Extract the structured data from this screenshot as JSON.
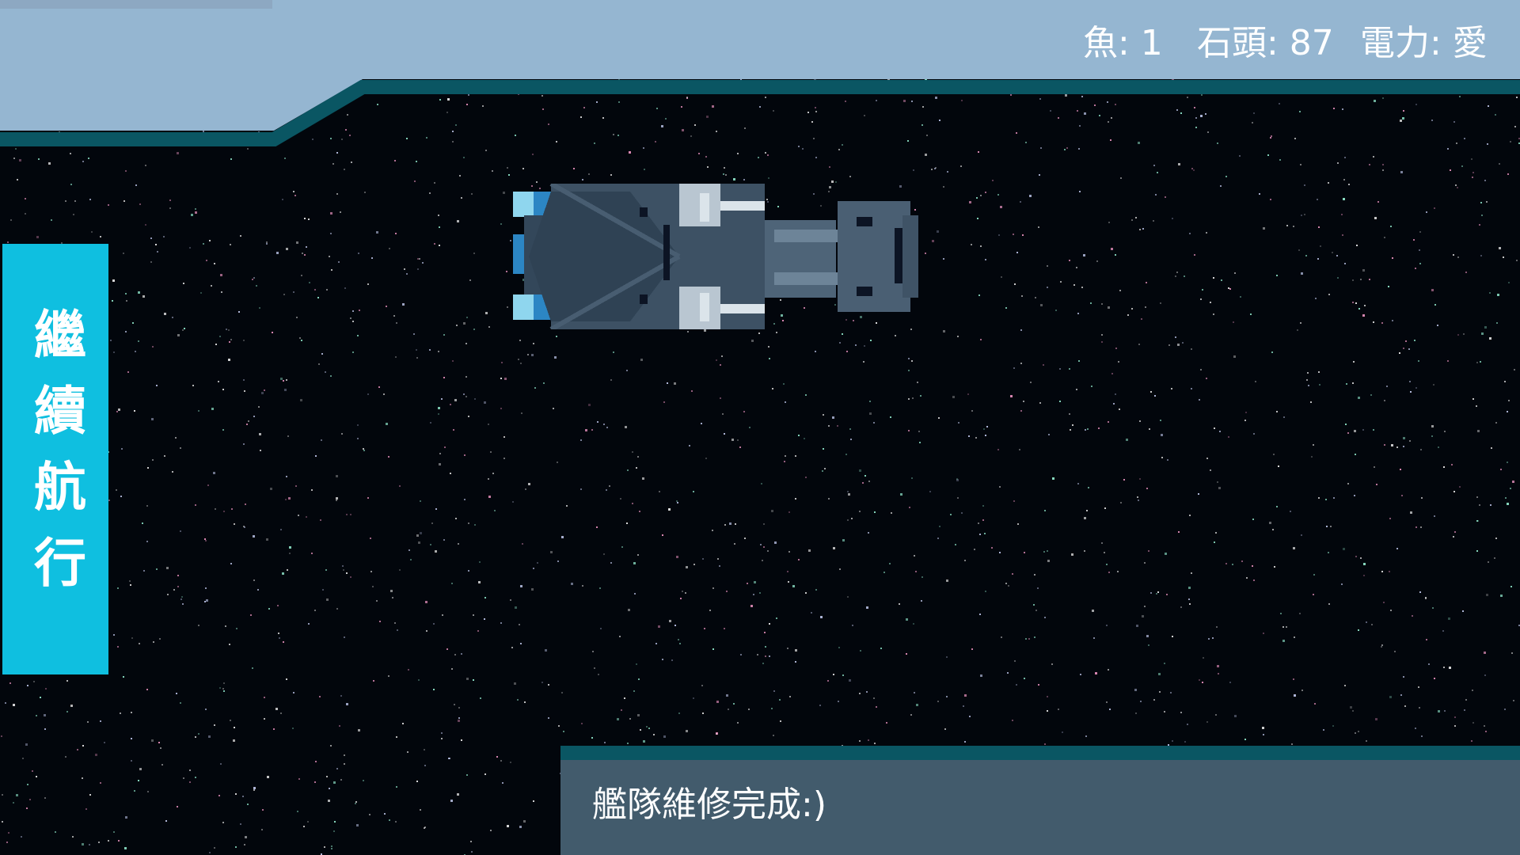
{
  "resources": {
    "fish": "魚: 1",
    "stone": "石頭: 87",
    "power": "電力: 愛"
  },
  "actions": {
    "continue_label": "繼續航行"
  },
  "message": {
    "text": "艦隊維修完成:)"
  },
  "colors": {
    "space": "#02060c",
    "hud_light": "#95b6d1",
    "hud_border": "#0a5663",
    "button": "#0fbfe0",
    "message_panel": "#425b6c"
  },
  "icons": {
    "ship": "spaceship-sprite"
  }
}
